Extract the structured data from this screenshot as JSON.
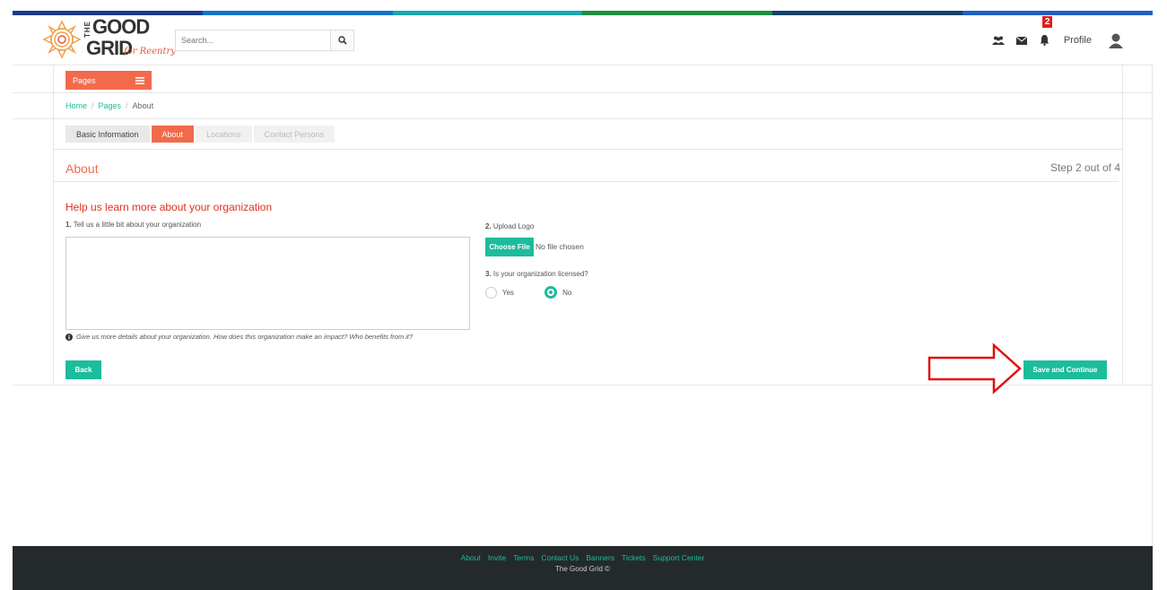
{
  "header": {
    "colorbar": [
      "#1a3a8a",
      "#1473c9",
      "#17a8b0",
      "#1f8f3e",
      "#14406b",
      "#1f5fc4"
    ],
    "logo": {
      "the": "THE",
      "good": "GOOD",
      "grid": "GRID",
      "tagline": "for Reentry"
    },
    "search": {
      "placeholder": "Search...",
      "icon": "search-icon"
    },
    "icons": [
      "group-icon",
      "envelope-icon",
      "bell-icon"
    ],
    "notification_count": "2",
    "profile_label": "Profile",
    "avatar_icon": "user-avatar-icon"
  },
  "pages_menu": {
    "label": "Pages",
    "icon": "hamburger-icon"
  },
  "breadcrumb": {
    "home": "Home",
    "sep1": "/",
    "pages": "Pages",
    "sep2": "/",
    "current": "About"
  },
  "tabs": [
    {
      "label": "Basic Information",
      "state": "normal"
    },
    {
      "label": "About",
      "state": "active"
    },
    {
      "label": "Locations",
      "state": "disabled"
    },
    {
      "label": "Contact Persons",
      "state": "disabled"
    }
  ],
  "section": {
    "title": "About",
    "step": "Step 2 out of 4"
  },
  "form": {
    "heading": "Help us learn more about your organization",
    "q1": {
      "number": "1.",
      "label": "Tell us a little bit about your organization",
      "value": ""
    },
    "hint": "Give us more details about your organization. How does this organization make an impact? Who benefits from it?",
    "q2": {
      "number": "2.",
      "label": "Upload Logo",
      "button": "Choose File",
      "status": "No file chosen"
    },
    "q3": {
      "number": "3.",
      "label": "Is your organization licensed?",
      "options": [
        "Yes",
        "No"
      ],
      "selected": "No"
    },
    "back_label": "Back",
    "save_label": "Save and Continue"
  },
  "colors": {
    "accent": "#f26a4b",
    "teal": "#1cbc9c",
    "arrow": "#e01010"
  },
  "footer": {
    "links": [
      "About",
      "Invite",
      "Terms",
      "Contact Us",
      "Banners",
      "Tickets",
      "Support Center"
    ],
    "copyright": "The Good Grid ©"
  }
}
